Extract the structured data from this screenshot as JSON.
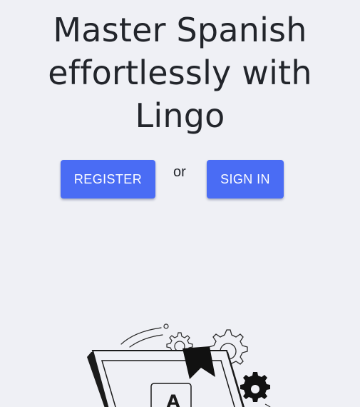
{
  "hero": {
    "title_lines": [
      "Master Spanish",
      "effortlessly with",
      "Lingo"
    ]
  },
  "actions": {
    "register_label": "REGISTER",
    "separator": "or",
    "signin_label": "SIGN IN"
  },
  "illustration": {
    "book_letter": "A"
  },
  "colors": {
    "background": "#eff0f5",
    "primary_button": "#4a6cf4",
    "text": "#22252b"
  }
}
